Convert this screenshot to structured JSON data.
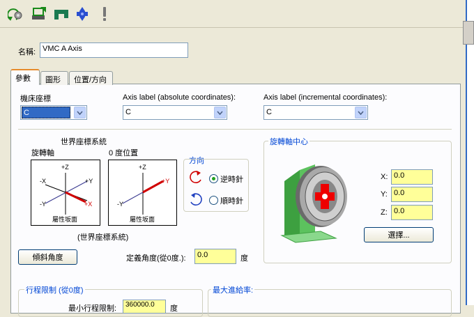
{
  "toolbar": {
    "icons": [
      "refresh-axis-icon",
      "axis-set-icon",
      "axis-clear-icon",
      "blue-gear-icon",
      "warning-icon"
    ]
  },
  "name": {
    "label": "名稱:",
    "value": "VMC A Axis"
  },
  "tabs": [
    {
      "label": "參數",
      "active": true
    },
    {
      "label": "圖形",
      "active": false
    },
    {
      "label": "位置/方向",
      "active": false
    }
  ],
  "machine_coord": {
    "label": "機床座標",
    "value": "C"
  },
  "axis_label_abs": {
    "label": "Axis label (absolute coordinates):",
    "value": "C"
  },
  "axis_label_inc": {
    "label": "Axis label (incremental coordinates):",
    "value": "C"
  },
  "world_coord": {
    "title": "世界座標系統",
    "rotation_axis_label": "旋轉軸",
    "zero_position_label": "0 度位置",
    "diagram1": {
      "top": "+Z",
      "left": "-X",
      "right": "+Y",
      "bottom_left": "-Y",
      "bottom_right": "+X",
      "caption": "屬性坂面"
    },
    "diagram2": {
      "top": "+Z",
      "right": "+Y",
      "left": "-Y",
      "caption": "屬性坂面"
    },
    "footer": "(世界座標系統)"
  },
  "direction": {
    "title": "方向",
    "ccw": "逆時針",
    "cw": "順時針",
    "selected": "ccw"
  },
  "rotation_center": {
    "title": "旋轉軸中心",
    "x_label": "X:",
    "x_value": "0.0",
    "y_label": "Y:",
    "y_value": "0.0",
    "z_label": "Z:",
    "z_value": "0.0",
    "select_button": "選擇..."
  },
  "tilt": {
    "button": "傾斜角度",
    "define_label": "定義角度(從0度.):",
    "value": "0.0",
    "unit": "度"
  },
  "travel_limit": {
    "title": "行程限制 (從0度)",
    "min_label": "最小行程限制:",
    "min_value": "360000.0",
    "unit": "度"
  },
  "max_feed": {
    "title": "最大進給率:"
  },
  "colors": {
    "selection": "#316ac5",
    "yellow_field": "#ffff99",
    "group_title": "#0046d5",
    "red": "#e00000"
  }
}
